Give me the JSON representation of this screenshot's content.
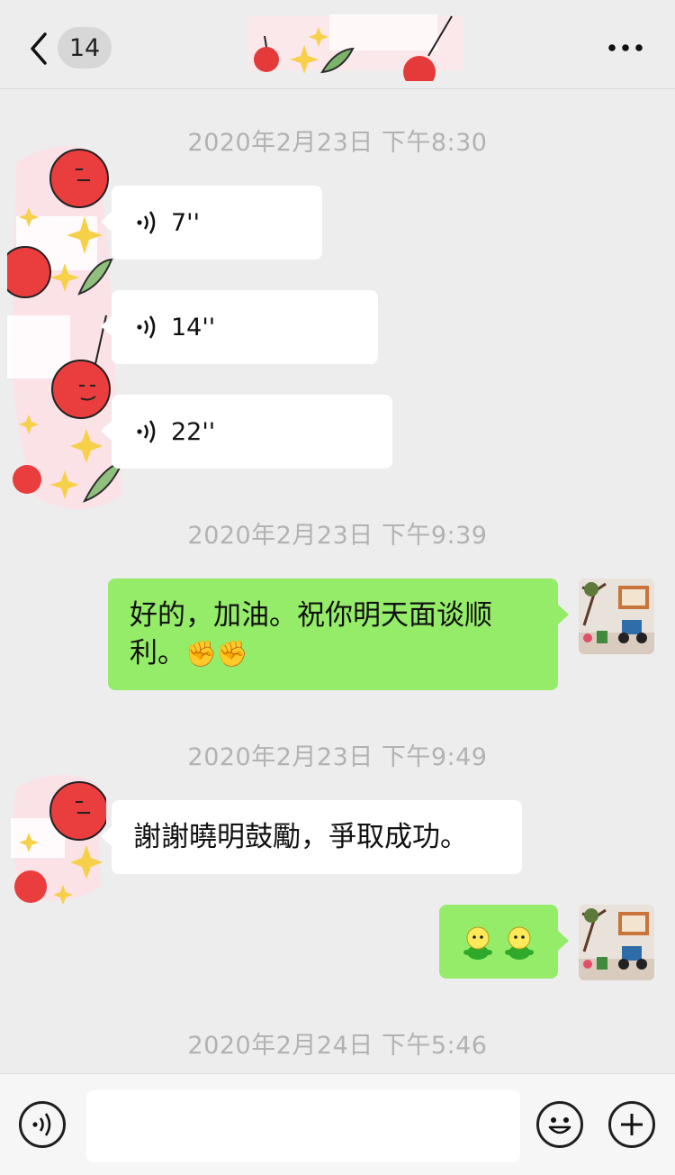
{
  "header": {
    "back_icon": "chevron-left-icon",
    "unread_count": "14",
    "more_icon": "more-dots-icon"
  },
  "messages": {
    "ts1": "2020年2月23日 下午8:30",
    "voice1": "7''",
    "voice2": "14''",
    "voice3": "22''",
    "ts2": "2020年2月23日 下午9:39",
    "out1_text": "好的，加油。祝你明天面谈顺利。",
    "out1_emoji": "✊✊",
    "ts3": "2020年2月23日 下午9:49",
    "in4_text": "謝謝曉明鼓勵，爭取成功。",
    "out2_emoji_icon": "green-figure-emoji",
    "ts4": "2020年2月24日 下午5:46"
  },
  "inputbar": {
    "voice_icon": "voice-icon",
    "emoji_icon": "smiley-icon",
    "plus_icon": "plus-circle-icon",
    "text_value": ""
  },
  "colors": {
    "background": "#ededed",
    "green_bubble": "#95ec69",
    "white_bubble": "#ffffff",
    "timestamp": "#b2b2b2"
  }
}
